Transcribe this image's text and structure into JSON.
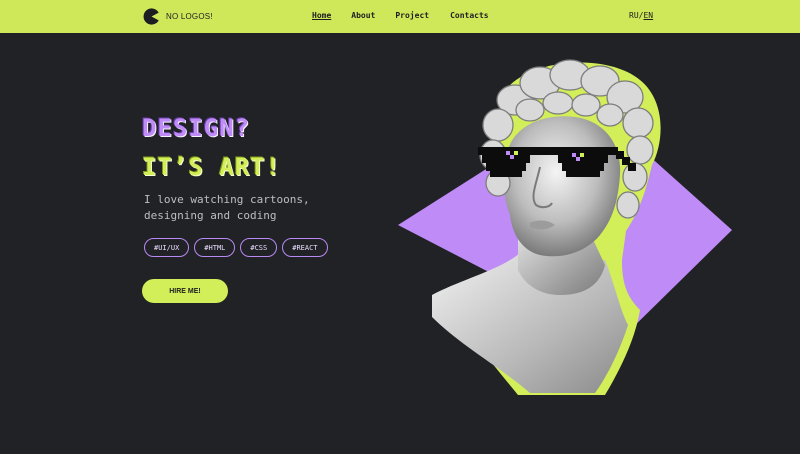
{
  "brand": {
    "logo_text": "NO LOGOS!",
    "logo_icon": "pacman-logo-icon"
  },
  "nav": {
    "items": [
      {
        "label": "Home",
        "active": true
      },
      {
        "label": "About"
      },
      {
        "label": "Project"
      },
      {
        "label": "Contacts"
      }
    ]
  },
  "lang": {
    "ru": "RU",
    "separator": "/",
    "en": "EN",
    "active": "EN"
  },
  "hero": {
    "title_line1": "DESIGN?",
    "title_line2": "IT’S ART!",
    "subtitle": "I love watching cartoons, designing and coding",
    "tags": [
      "#UI/UX",
      "#HTML",
      "#CSS",
      "#REACT"
    ],
    "cta": "HIRE ME!"
  },
  "illustration": {
    "subject": "statue-bust-with-pixel-sunglasses"
  },
  "colors": {
    "background": "#212226",
    "accent_lime": "#d2ee58",
    "accent_purple": "#bf8bf6"
  }
}
